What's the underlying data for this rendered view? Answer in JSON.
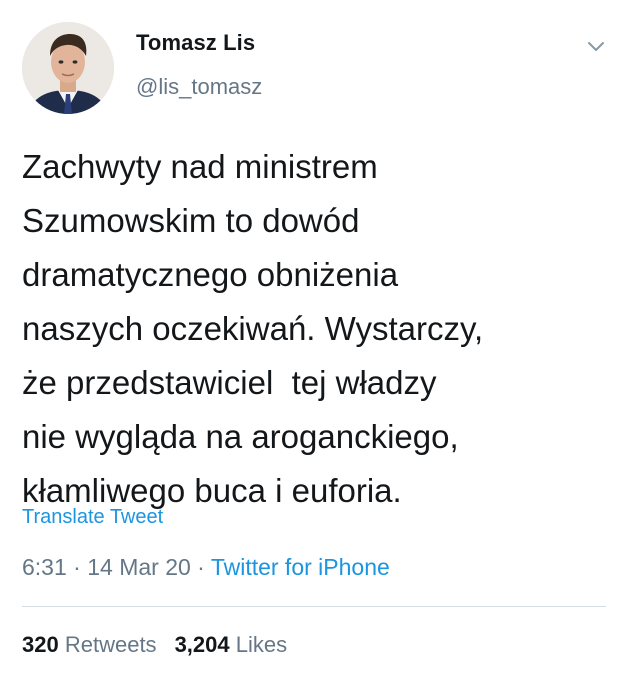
{
  "author": {
    "display_name": "Tomasz Lis",
    "handle": "@lis_tomasz",
    "avatar_icon": "profile-photo"
  },
  "menu": {
    "icon": "chevron-down-icon"
  },
  "tweet": {
    "lines": [
      "Zachwyty nad ministrem",
      "Szumowskim to dowód",
      "dramatycznego obniżenia",
      "naszych oczekiwań. Wystarczy,",
      "że przedstawiciel  tej władzy",
      "nie wygląda na aroganckiego,",
      "kłamliwego buca i euforia."
    ],
    "translate_label": "Translate Tweet"
  },
  "meta": {
    "time": "6:31",
    "separator": " · ",
    "date": "14 Mar 20",
    "source": "Twitter for iPhone"
  },
  "stats": {
    "retweets_count": "320",
    "retweets_label": "Retweets",
    "likes_count": "3,204",
    "likes_label": "Likes"
  },
  "colors": {
    "text": "#14171a",
    "secondary": "#657786",
    "link": "#1b95e0",
    "divider": "#d6dde2"
  }
}
